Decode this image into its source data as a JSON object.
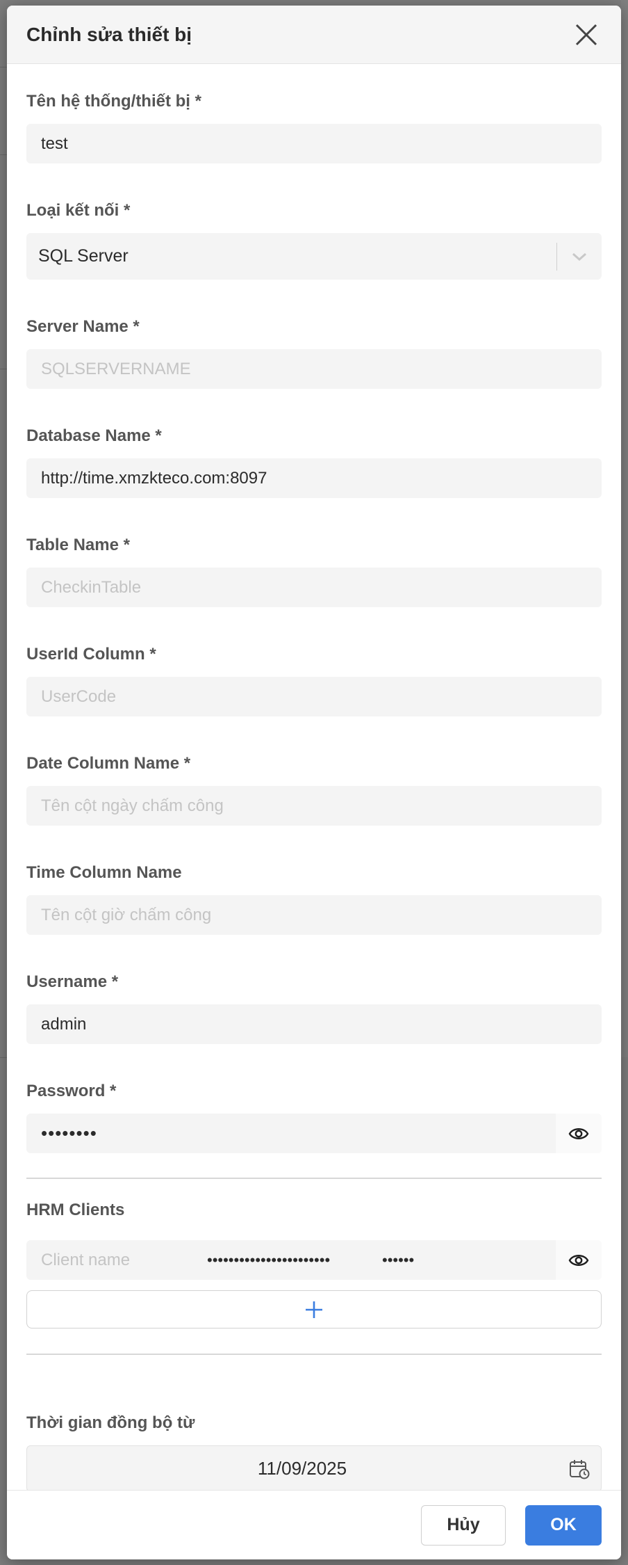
{
  "dialog": {
    "title": "Chỉnh sửa thiết bị",
    "close_icon": "close-icon"
  },
  "fields": {
    "system_name": {
      "label": "Tên hệ thống/thiết bị *",
      "value": "test",
      "placeholder": ""
    },
    "connection_type": {
      "label": "Loại kết nối *",
      "value": "SQL Server",
      "icon": "chevron-down-icon"
    },
    "server_name": {
      "label": "Server Name *",
      "value": "",
      "placeholder": "SQLSERVERNAME"
    },
    "database_name": {
      "label": "Database Name *",
      "value": "http://time.xmzkteco.com:8097",
      "placeholder": ""
    },
    "table_name": {
      "label": "Table Name *",
      "value": "",
      "placeholder": "CheckinTable"
    },
    "userid_column": {
      "label": "UserId Column *",
      "value": "",
      "placeholder": "UserCode"
    },
    "date_column": {
      "label": "Date Column Name *",
      "value": "",
      "placeholder": "Tên cột ngày chấm công"
    },
    "time_column": {
      "label": "Time Column Name",
      "value": "",
      "placeholder": "Tên cột giờ chấm công"
    },
    "username": {
      "label": "Username *",
      "value": "admin",
      "placeholder": ""
    },
    "password": {
      "label": "Password *",
      "masked": "••••••••",
      "icon": "eye-icon"
    }
  },
  "hrm_clients": {
    "label": "HRM Clients",
    "rows": [
      {
        "name_placeholder": "Client name",
        "secret_masked": "•••••••••••••••••••••••",
        "code_masked": "••••••",
        "icon": "eye-icon"
      }
    ],
    "add_icon": "plus-icon"
  },
  "sync": {
    "label": "Thời gian đồng bộ từ",
    "date": "11/09/2025",
    "icon": "calendar-clock-icon"
  },
  "footer": {
    "cancel_label": "Hủy",
    "ok_label": "OK"
  },
  "colors": {
    "primary": "#3a7de0",
    "input_bg": "#f4f4f4",
    "overlay": "#8f8f8f"
  }
}
